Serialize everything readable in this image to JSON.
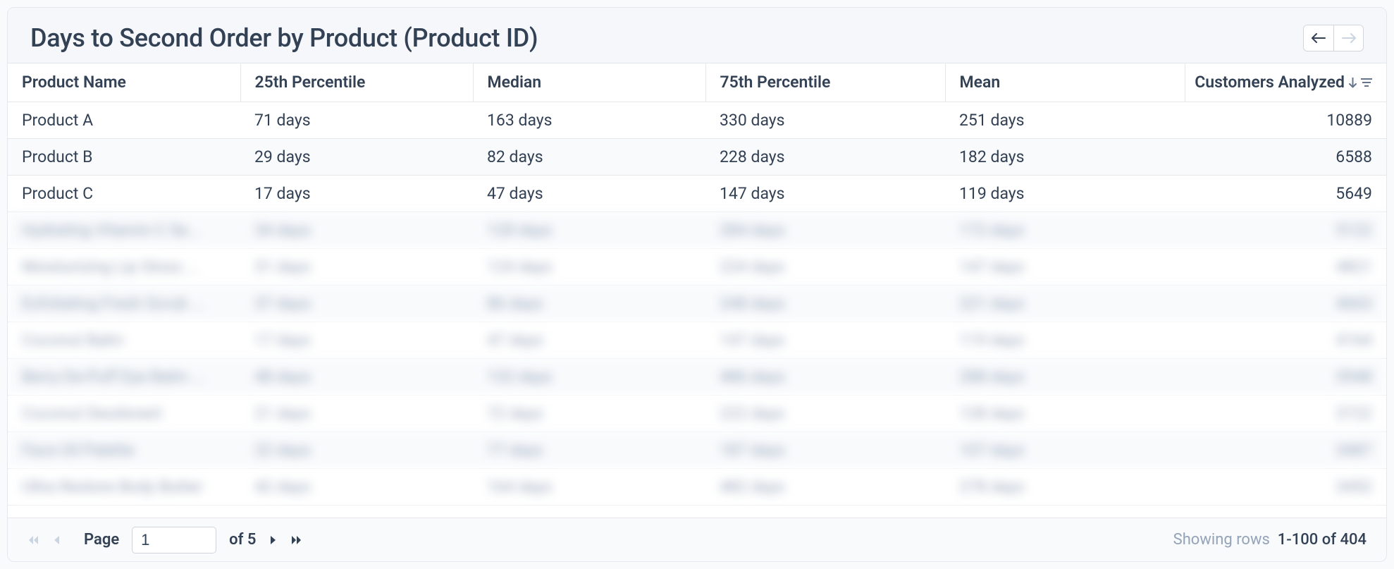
{
  "title": "Days to Second Order by Product (Product ID)",
  "columns": [
    "Product Name",
    "25th Percentile",
    "Median",
    "75th Percentile",
    "Mean",
    "Customers Analyzed"
  ],
  "rows": [
    {
      "name": "Product A",
      "p25": "71 days",
      "median": "163 days",
      "p75": "330 days",
      "mean": "251 days",
      "customers": "10889",
      "blurred": false
    },
    {
      "name": "Product B",
      "p25": "29 days",
      "median": "82 days",
      "p75": "228 days",
      "mean": "182 days",
      "customers": "6588",
      "blurred": false
    },
    {
      "name": "Product C",
      "p25": "17 days",
      "median": "47 days",
      "p75": "147 days",
      "mean": "119 days",
      "customers": "5649",
      "blurred": false
    },
    {
      "name": "Hydrating Vitamin C Se...",
      "p25": "34 days",
      "median": "128 days",
      "p75": "284 days",
      "mean": "172 days",
      "customers": "5122",
      "blurred": true
    },
    {
      "name": "Moisturizing Lip Gloss ...",
      "p25": "31 days",
      "median": "124 days",
      "p75": "224 days",
      "mean": "147 days",
      "customers": "4821",
      "blurred": true
    },
    {
      "name": "Exfoliating Fresh Scrub ...",
      "p25": "37 days",
      "median": "86 days",
      "p75": "248 days",
      "mean": "221 days",
      "customers": "4663",
      "blurred": true
    },
    {
      "name": "Coconut Balm",
      "p25": "17 days",
      "median": "47 days",
      "p75": "147 days",
      "mean": "119 days",
      "customers": "4164",
      "blurred": true
    },
    {
      "name": "Berry De-Puff Eye Balm ...",
      "p25": "48 days",
      "median": "132 days",
      "p75": "486 days",
      "mean": "288 days",
      "customers": "3948",
      "blurred": true
    },
    {
      "name": "Coconut Deodorant",
      "p25": "21 days",
      "median": "72 days",
      "p75": "222 days",
      "mean": "128 days",
      "customers": "3722",
      "blurred": true
    },
    {
      "name": "Face Oil Palette",
      "p25": "22 days",
      "median": "77 days",
      "p75": "187 days",
      "mean": "107 days",
      "customers": "3487",
      "blurred": true
    },
    {
      "name": "Ultra Restore Body Butter",
      "p25": "42 days",
      "median": "164 days",
      "p75": "482 days",
      "mean": "278 days",
      "customers": "3452",
      "blurred": true
    }
  ],
  "pagination": {
    "page_label": "Page",
    "current_page": "1",
    "of_label": "of 5",
    "rows_label": "Showing rows",
    "rows_range": "1-100 of 404"
  }
}
